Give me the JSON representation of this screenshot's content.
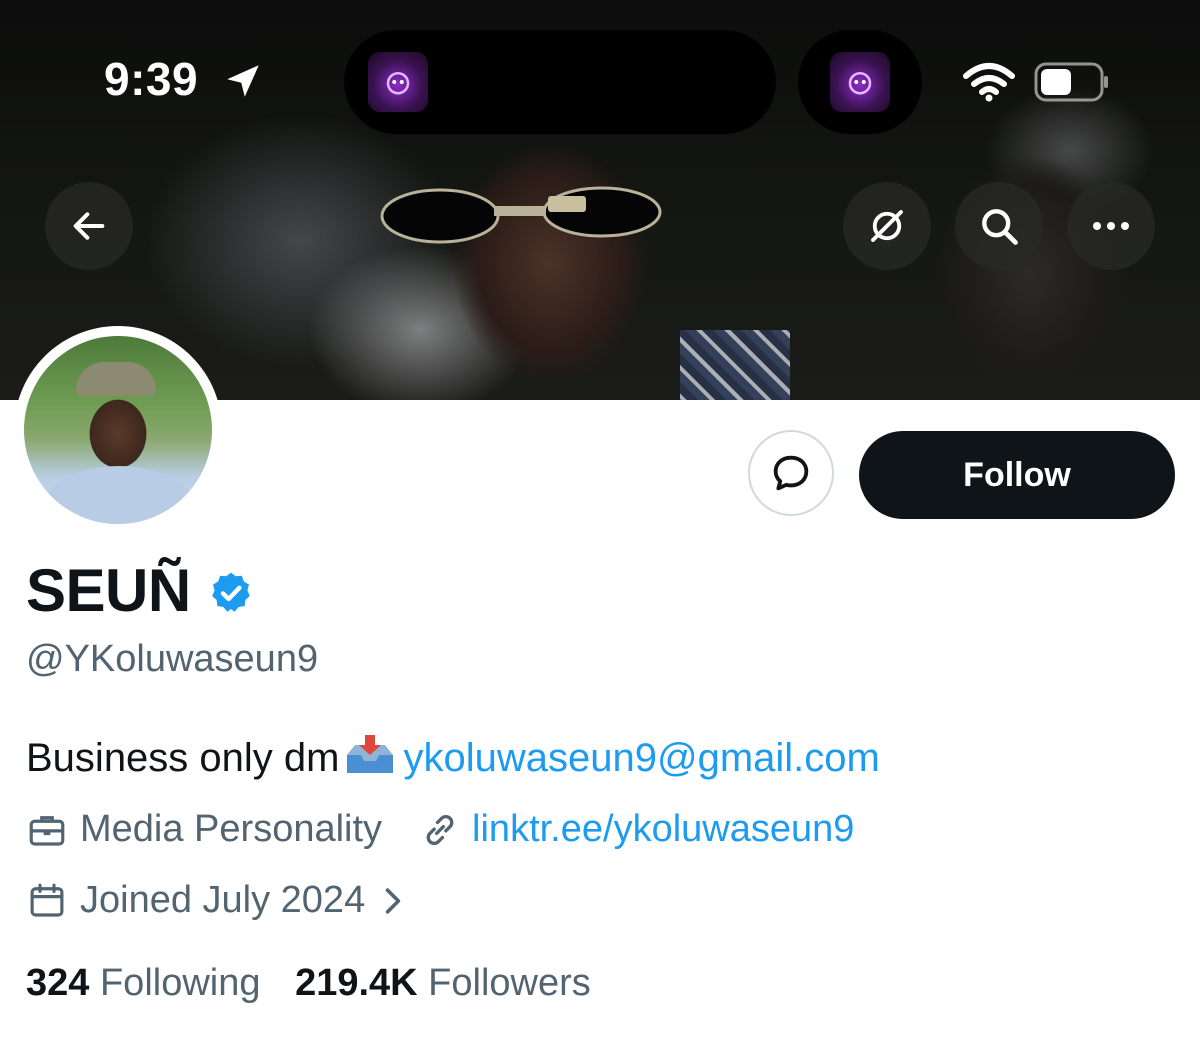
{
  "status_bar": {
    "time": "9:39"
  },
  "profile": {
    "display_name": "SEUÑ",
    "handle": "@YKoluwaseun9",
    "bio_text": "Business only dm",
    "bio_email": "ykoluwaseun9@gmail.com",
    "category": "Media Personality",
    "website": "linktr.ee/ykoluwaseun9",
    "joined": "Joined July 2024",
    "following_count": "324",
    "following_label": "Following",
    "followers_count": "219.4K",
    "followers_label": "Followers"
  },
  "actions": {
    "follow_label": "Follow"
  },
  "colors": {
    "accent": "#1d9bf0",
    "text": "#0f1419",
    "muted": "#536471"
  },
  "icons": [
    "back-arrow-icon",
    "unfollow-list-icon",
    "search-icon",
    "more-icon",
    "message-icon",
    "verified-badge-icon",
    "briefcase-icon",
    "link-icon",
    "calendar-icon",
    "chevron-right-icon",
    "location-arrow-icon",
    "wifi-icon",
    "battery-icon"
  ]
}
